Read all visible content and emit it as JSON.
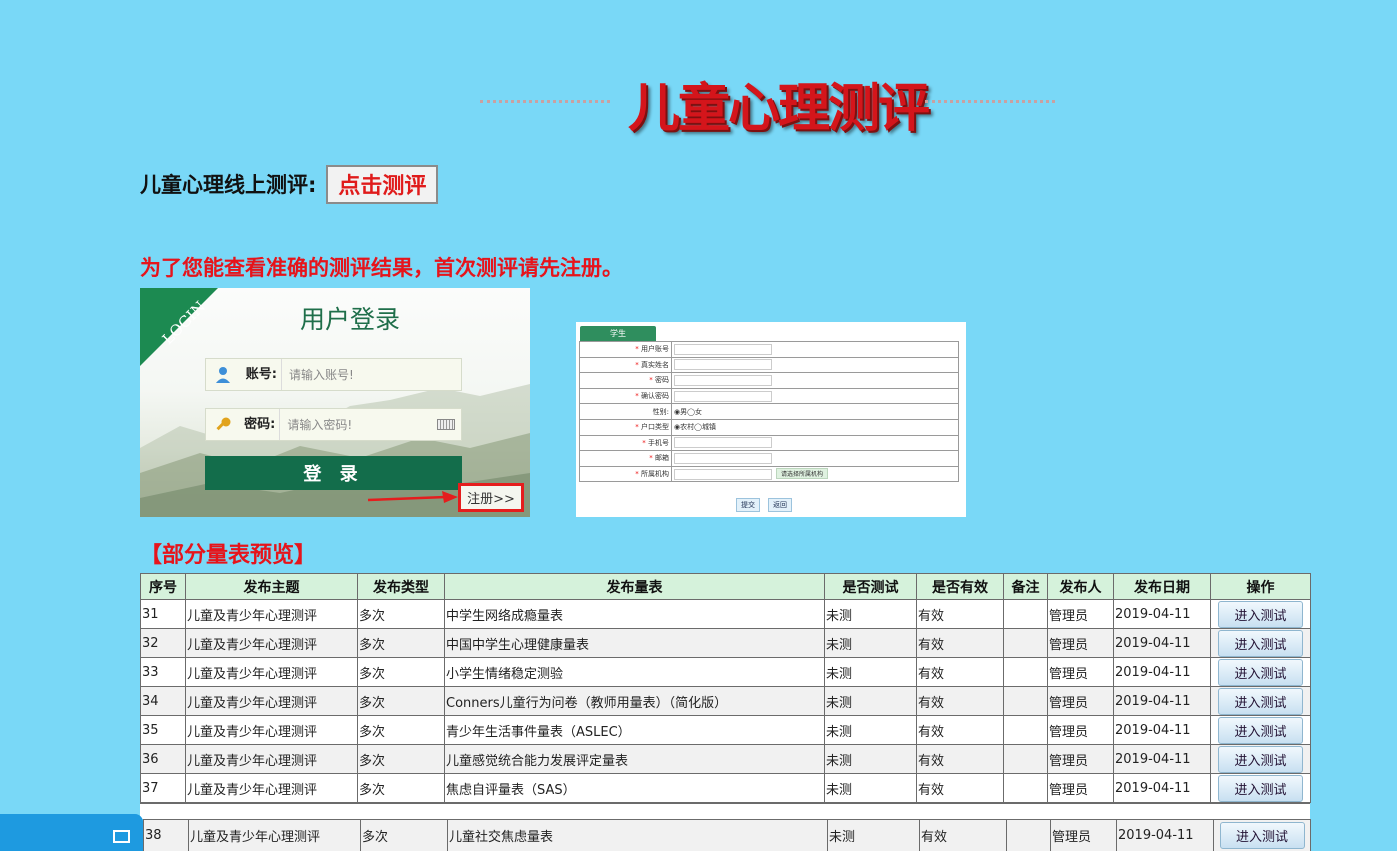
{
  "page": {
    "title": "儿童心理测评",
    "online_label": "儿童心理线上测评:",
    "eval_button": "点击测评",
    "notice": "为了您能查看准确的测评结果，首次测评请先注册。",
    "preview_heading": "【部分量表预览】"
  },
  "login": {
    "ribbon": "LOGIN",
    "title": "用户登录",
    "account_label": "账号:",
    "account_placeholder": "请输入账号!",
    "password_label": "密码:",
    "password_placeholder": "请输入密码!",
    "login_button": "登 录",
    "register_link": "注册>>"
  },
  "register": {
    "tab": "学生",
    "fields": [
      {
        "label": "用户账号",
        "required": true,
        "value": ""
      },
      {
        "label": "真实姓名",
        "required": true,
        "value": ""
      },
      {
        "label": "密码",
        "required": true,
        "value": ""
      },
      {
        "label": "确认密码",
        "required": true,
        "value": ""
      },
      {
        "label": "性别:",
        "required": false,
        "value": "◉男◯女"
      },
      {
        "label": "户口类型",
        "required": true,
        "value": "◉农村◯城镇"
      },
      {
        "label": "手机号",
        "required": true,
        "value": ""
      },
      {
        "label": "邮箱",
        "required": true,
        "value": ""
      },
      {
        "label": "所属机构",
        "required": true,
        "value": "",
        "button": "请选择所属机构"
      }
    ],
    "submit": "提交",
    "back": "返回"
  },
  "table": {
    "headers": [
      "序号",
      "发布主题",
      "发布类型",
      "发布量表",
      "是否测试",
      "是否有效",
      "备注",
      "发布人",
      "发布日期",
      "操作"
    ],
    "action_label": "进入测试",
    "rows": [
      {
        "no": "31",
        "topic": "儿童及青少年心理测评",
        "type": "多次",
        "scale": "中学生网络成瘾量表",
        "tested": "未测",
        "valid": "有效",
        "note": "",
        "publisher": "管理员",
        "date": "2019-04-11"
      },
      {
        "no": "32",
        "topic": "儿童及青少年心理测评",
        "type": "多次",
        "scale": "中国中学生心理健康量表",
        "tested": "未测",
        "valid": "有效",
        "note": "",
        "publisher": "管理员",
        "date": "2019-04-11"
      },
      {
        "no": "33",
        "topic": "儿童及青少年心理测评",
        "type": "多次",
        "scale": "小学生情绪稳定测验",
        "tested": "未测",
        "valid": "有效",
        "note": "",
        "publisher": "管理员",
        "date": "2019-04-11"
      },
      {
        "no": "34",
        "topic": "儿童及青少年心理测评",
        "type": "多次",
        "scale": "Conners儿童行为问卷（教师用量表）（简化版）",
        "tested": "未测",
        "valid": "有效",
        "note": "",
        "publisher": "管理员",
        "date": "2019-04-11"
      },
      {
        "no": "35",
        "topic": "儿童及青少年心理测评",
        "type": "多次",
        "scale": "青少年生活事件量表（ASLEC）",
        "tested": "未测",
        "valid": "有效",
        "note": "",
        "publisher": "管理员",
        "date": "2019-04-11"
      },
      {
        "no": "36",
        "topic": "儿童及青少年心理测评",
        "type": "多次",
        "scale": "儿童感觉统合能力发展评定量表",
        "tested": "未测",
        "valid": "有效",
        "note": "",
        "publisher": "管理员",
        "date": "2019-04-11"
      },
      {
        "no": "37",
        "topic": "儿童及青少年心理测评",
        "type": "多次",
        "scale": "焦虑自评量表（SAS）",
        "tested": "未测",
        "valid": "有效",
        "note": "",
        "publisher": "管理员",
        "date": "2019-04-11"
      }
    ],
    "last_row": {
      "no": "38",
      "topic": "儿童及青少年心理测评",
      "type": "多次",
      "scale": "儿童社交焦虑量表",
      "tested": "未测",
      "valid": "有效",
      "note": "",
      "publisher": "管理员",
      "date": "2019-04-11"
    }
  },
  "icons": {
    "user": "user-icon",
    "key": "key-icon",
    "keyboard": "keyboard-icon",
    "side_window": "window-icon"
  },
  "colors": {
    "background": "#79d8f7",
    "title_red": "#d4151b",
    "login_green": "#136d4b",
    "table_header": "#d5f2db",
    "side_tab": "#1e9ae0"
  }
}
